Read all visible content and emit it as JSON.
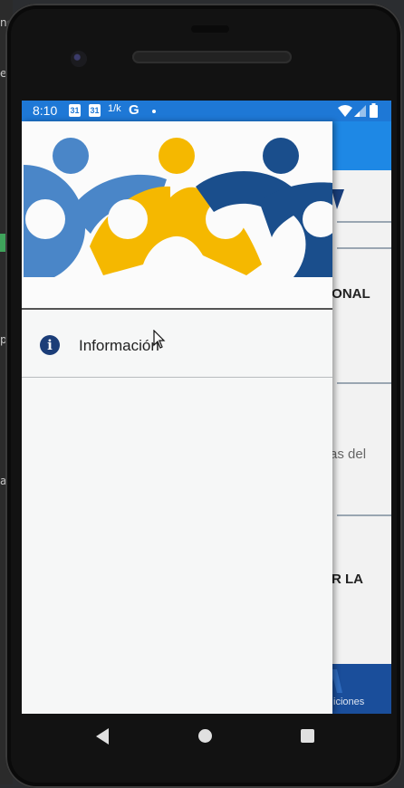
{
  "ide": {
    "frag1": "ner",
    "frag2": "e",
    "frag3": "p",
    "frag4": "a"
  },
  "status_bar": {
    "time": "8:10",
    "icons": [
      "calendar-icon",
      "calendar-icon",
      "data-saver-icon",
      "google-icon",
      "dot-icon",
      "wifi-icon",
      "signal-icon",
      "battery-icon"
    ],
    "cal1": "31",
    "cal2": "31",
    "misc": "1/k",
    "g": "G"
  },
  "background_app": {
    "row1": "IONAL",
    "row2": "as del",
    "row3": "R LA",
    "bottom_nav_label": "iciones"
  },
  "drawer": {
    "logo_colors": [
      "#4a86c8",
      "#f5b800",
      "#1a4e8c"
    ],
    "items": [
      {
        "label": "Información",
        "icon": "info-icon"
      }
    ]
  },
  "navbar": {
    "buttons": [
      "back-button",
      "home-button",
      "recents-button"
    ]
  }
}
